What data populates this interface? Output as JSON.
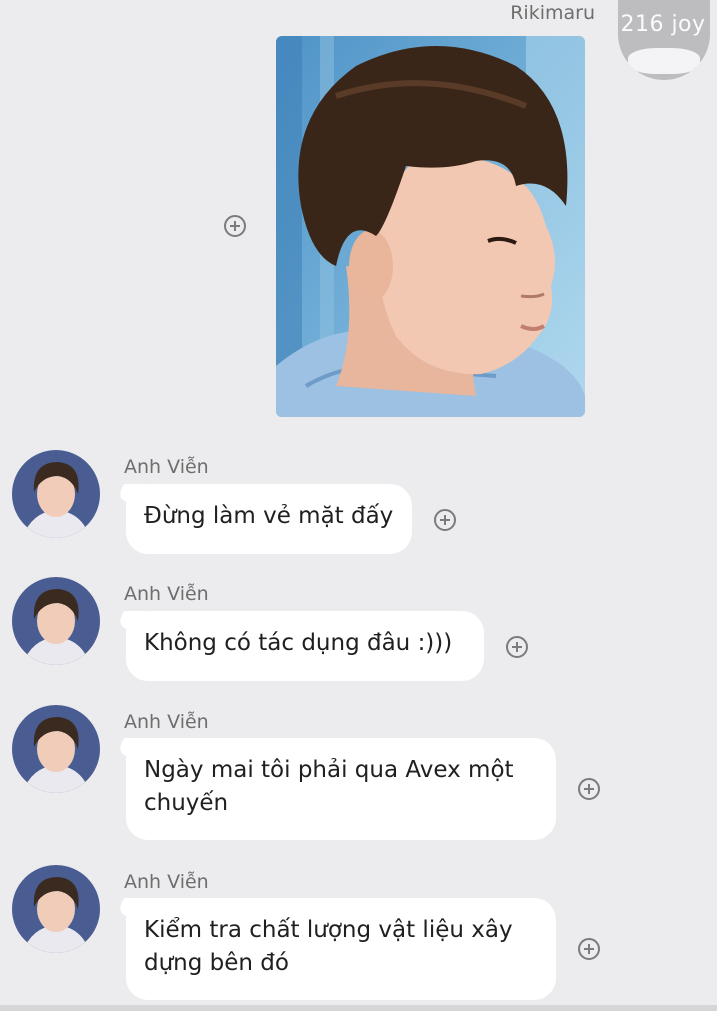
{
  "header": {
    "sender_name": "Rikimaru",
    "avatar_badge": "216 joy"
  },
  "messages": [
    {
      "name": "Anh Viễn",
      "text": "Đừng làm vẻ mặt đấy"
    },
    {
      "name": "Anh Viễn",
      "text": "Không có tác dụng đâu :)))"
    },
    {
      "name": "Anh Viễn",
      "text": "Ngày mai tôi phải qua Avex một chuyến"
    },
    {
      "name": "Anh Viễn",
      "text": "Kiểm tra chất lượng vật liệu xây dựng bên đó"
    }
  ],
  "icons": {
    "add": "plus-circle-icon"
  },
  "colors": {
    "background": "#ececee",
    "bubble": "#ffffff",
    "photo_bg": "#6aa6cf"
  }
}
